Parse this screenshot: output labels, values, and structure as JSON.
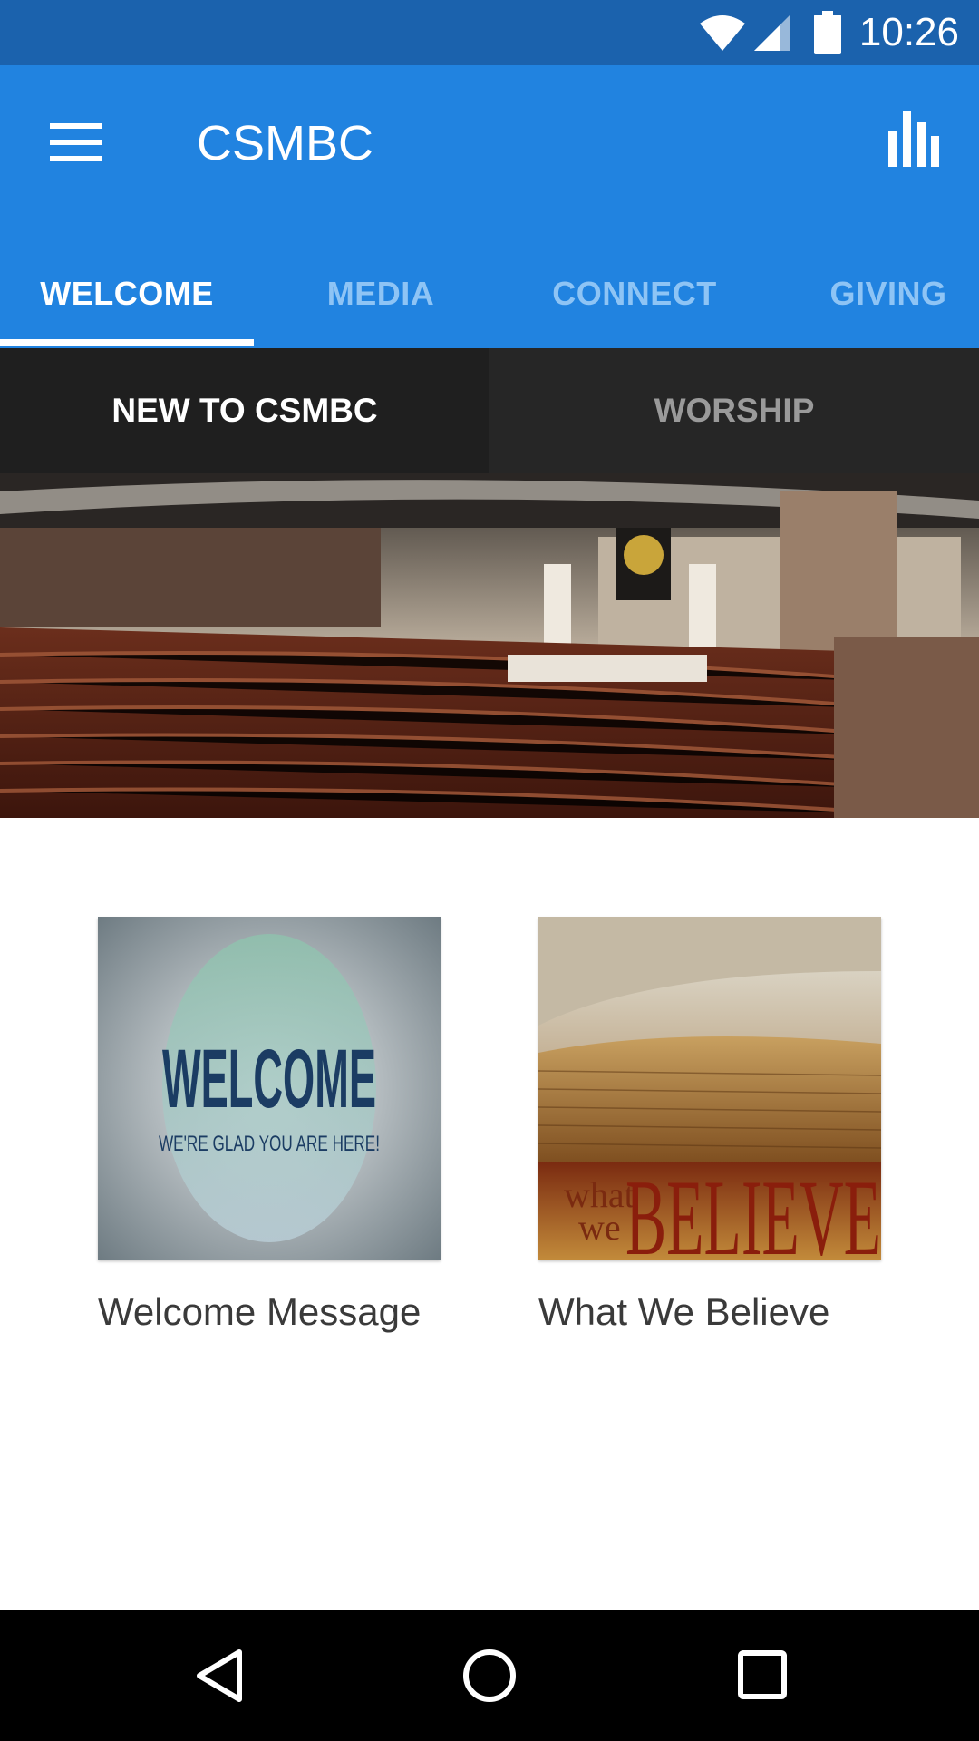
{
  "status_bar": {
    "time": "10:26"
  },
  "app_bar": {
    "title": "CSMBC",
    "menu_icon": "hamburger-menu-icon",
    "action_icon": "bar-chart-icon"
  },
  "tabs": [
    {
      "label": "WELCOME",
      "active": true
    },
    {
      "label": "MEDIA",
      "active": false
    },
    {
      "label": "CONNECT",
      "active": false
    },
    {
      "label": "GIVING",
      "active": false
    }
  ],
  "subtabs": [
    {
      "label": "NEW TO CSMBC",
      "active": true
    },
    {
      "label": "WORSHIP",
      "active": false
    }
  ],
  "cards": [
    {
      "label": "Welcome Message",
      "image_title": "WELCOME",
      "image_subtitle": "WE'RE GLAD YOU ARE HERE!"
    },
    {
      "label": "What We Believe",
      "image_text_small_1": "what",
      "image_text_small_2": "we",
      "image_text_large": "BELIEVE"
    }
  ],
  "colors": {
    "status_bar": "#1b62ad",
    "app_bar": "#2183e0",
    "subtab_bar": "#222222",
    "nav_bar": "#000000"
  }
}
